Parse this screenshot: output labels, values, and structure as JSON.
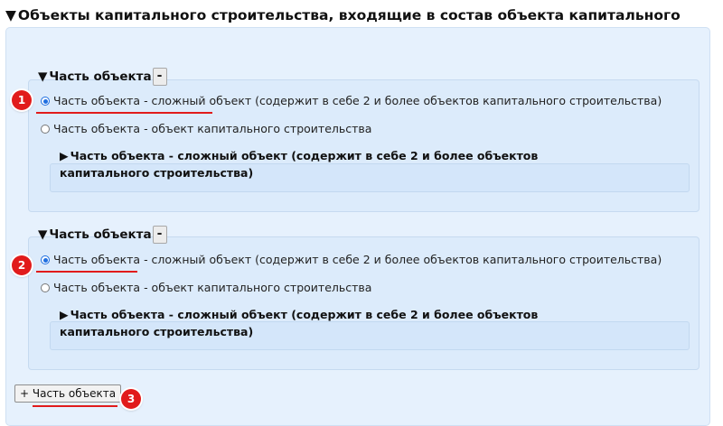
{
  "main": {
    "title": "Объекты капитального строительства, входящие в состав объекта капитального строительства",
    "toggle_symbol": "▼",
    "minus_label": "-"
  },
  "parts": [
    {
      "title": "Часть объекта",
      "toggle_symbol": "▼",
      "minus_label": "-",
      "options": [
        {
          "label": "Часть объекта - сложный объект (содержит в себе 2 и более объектов капитального строительства)",
          "selected": true
        },
        {
          "label": "Часть объекта - объект капитального строительства",
          "selected": false
        }
      ],
      "subsection": {
        "toggle_symbol": "▶",
        "title": "Часть объекта - сложный объект (содержит в себе 2 и более объектов капитального строительства)"
      },
      "badge": "1"
    },
    {
      "title": "Часть объекта",
      "toggle_symbol": "▼",
      "minus_label": "-",
      "options": [
        {
          "label": "Часть объекта - сложный объект (содержит в себе 2 и более объектов капитального строительства)",
          "selected": true
        },
        {
          "label": "Часть объекта - объект капитального строительства",
          "selected": false
        }
      ],
      "subsection": {
        "toggle_symbol": "▶",
        "title": "Часть объекта - сложный объект (содержит в себе 2 и более объектов капитального строительства)"
      },
      "badge": "2"
    }
  ],
  "add_button_label": "+ Часть объекта",
  "add_badge": "3",
  "colors": {
    "badge": "#e11b1b",
    "panel": "#e6f1fd",
    "radio_selected": "#1f6fe0"
  }
}
